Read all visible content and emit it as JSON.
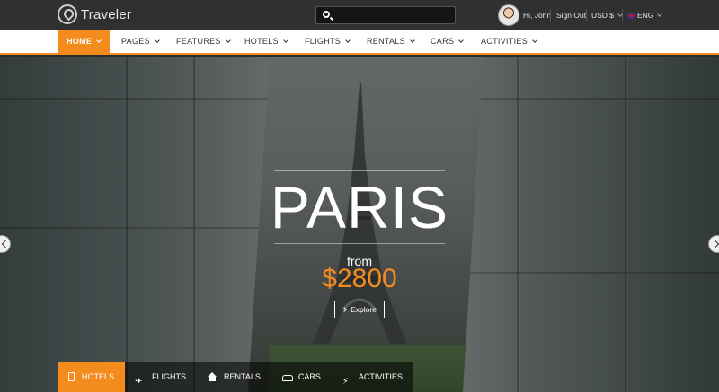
{
  "brand": {
    "name": "Traveler"
  },
  "search": {
    "placeholder": "",
    "value": ""
  },
  "user": {
    "greeting": "Hi, John",
    "sign_out": "Sign Out",
    "currency": "USD $",
    "language": "ENG"
  },
  "nav": {
    "items": [
      {
        "label": "HOME",
        "active": true
      },
      {
        "label": "PAGES"
      },
      {
        "label": "FEATURES"
      },
      {
        "label": "HOTELS"
      },
      {
        "label": "FLIGHTS"
      },
      {
        "label": "RENTALS"
      },
      {
        "label": "CARS"
      },
      {
        "label": "ACTIVITIES"
      }
    ]
  },
  "hero": {
    "title": "PARIS",
    "from": "from",
    "price": "$2800",
    "explore": "Explore"
  },
  "tabs": [
    {
      "label": "HOTELS",
      "icon": "hotel-icon",
      "active": true
    },
    {
      "label": "FLIGHTS",
      "icon": "plane-icon"
    },
    {
      "label": "RENTALS",
      "icon": "home-icon"
    },
    {
      "label": "CARS",
      "icon": "car-icon"
    },
    {
      "label": "ACTIVITIES",
      "icon": "bolt-icon"
    }
  ],
  "colors": {
    "accent": "#f48b1d",
    "topbar": "#303030"
  }
}
